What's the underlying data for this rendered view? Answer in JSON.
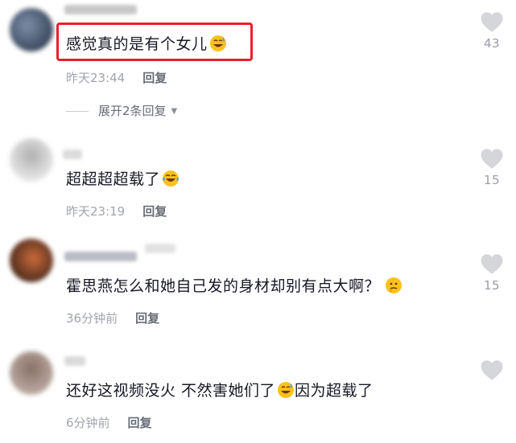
{
  "comments": [
    {
      "text": "感觉真的是有个女儿",
      "time": "昨天23:44",
      "reply_label": "回复",
      "likes": "43",
      "expand_label": "展开2条回复",
      "highlighted": true,
      "emoji": "grinning-face-with-sweat-icon"
    },
    {
      "text": "超超超超载了",
      "time": "昨天23:19",
      "reply_label": "回复",
      "likes": "15",
      "emoji": "tears-of-joy-icon"
    },
    {
      "text": "霍思燕怎么和她自己发的身材却别有点大啊？",
      "time": "36分钟前",
      "reply_label": "回复",
      "likes": "15",
      "emoji": "thinking-face-icon"
    },
    {
      "text": "还好这视频没火 不然害她们了",
      "text_suffix": "因为超载了",
      "time": "6分钟前",
      "reply_label": "回复",
      "likes": "",
      "emoji": "grinning-face-with-sweat-icon"
    }
  ],
  "colors": {
    "text": "#161823",
    "meta": "#a0a4ab",
    "reply": "#6a6e76",
    "like_icon": "#d4d6da",
    "highlight": "#e8202a"
  }
}
